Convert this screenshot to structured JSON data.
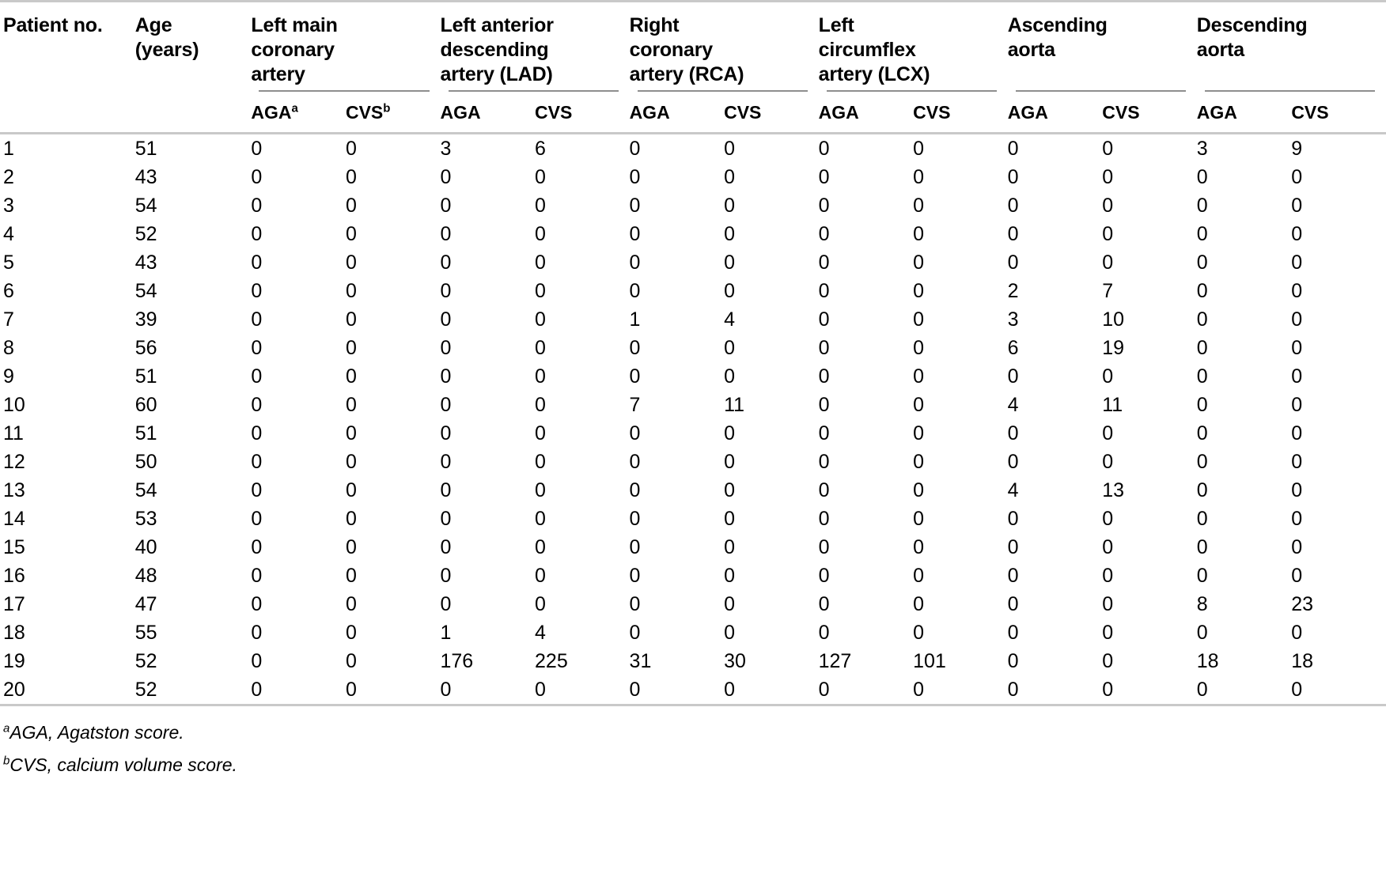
{
  "table": {
    "header": {
      "patient_no": "Patient no.",
      "age": "Age\n(years)",
      "age_line1": "Age",
      "age_line2": "(years)",
      "groups": [
        {
          "title": "Left main coronary artery",
          "lines": [
            "Left main",
            "coronary",
            "artery"
          ],
          "sub": [
            "AGA",
            "CVS"
          ],
          "sub_marks": [
            "a",
            "b"
          ]
        },
        {
          "title": "Left anterior descending artery (LAD)",
          "lines": [
            "Left anterior",
            "descending",
            "artery (LAD)"
          ],
          "sub": [
            "AGA",
            "CVS"
          ],
          "sub_marks": [
            "",
            ""
          ]
        },
        {
          "title": "Right coronary artery (RCA)",
          "lines": [
            "Right",
            "coronary",
            "artery (RCA)"
          ],
          "sub": [
            "AGA",
            "CVS"
          ],
          "sub_marks": [
            "",
            ""
          ]
        },
        {
          "title": "Left circumflex artery (LCX)",
          "lines": [
            "Left",
            "circumflex",
            "artery (LCX)"
          ],
          "sub": [
            "AGA",
            "CVS"
          ],
          "sub_marks": [
            "",
            ""
          ]
        },
        {
          "title": "Ascending aorta",
          "lines": [
            "Ascending",
            "aorta"
          ],
          "sub": [
            "AGA",
            "CVS"
          ],
          "sub_marks": [
            "",
            ""
          ]
        },
        {
          "title": "Descending aorta",
          "lines": [
            "Descending",
            "aorta"
          ],
          "sub": [
            "AGA",
            "CVS"
          ],
          "sub_marks": [
            "",
            ""
          ]
        }
      ]
    },
    "columns": [
      "Patient no.",
      "Age (years)",
      "Left main coronary artery AGA",
      "Left main coronary artery CVS",
      "LAD AGA",
      "LAD CVS",
      "RCA AGA",
      "RCA CVS",
      "LCX AGA",
      "LCX CVS",
      "Ascending aorta AGA",
      "Ascending aorta CVS",
      "Descending aorta AGA",
      "Descending aorta CVS"
    ],
    "rows": [
      {
        "patient": "1",
        "age": "51",
        "values": [
          "0",
          "0",
          "3",
          "6",
          "0",
          "0",
          "0",
          "0",
          "0",
          "0",
          "3",
          "9"
        ]
      },
      {
        "patient": "2",
        "age": "43",
        "values": [
          "0",
          "0",
          "0",
          "0",
          "0",
          "0",
          "0",
          "0",
          "0",
          "0",
          "0",
          "0"
        ]
      },
      {
        "patient": "3",
        "age": "54",
        "values": [
          "0",
          "0",
          "0",
          "0",
          "0",
          "0",
          "0",
          "0",
          "0",
          "0",
          "0",
          "0"
        ]
      },
      {
        "patient": "4",
        "age": "52",
        "values": [
          "0",
          "0",
          "0",
          "0",
          "0",
          "0",
          "0",
          "0",
          "0",
          "0",
          "0",
          "0"
        ]
      },
      {
        "patient": "5",
        "age": "43",
        "values": [
          "0",
          "0",
          "0",
          "0",
          "0",
          "0",
          "0",
          "0",
          "0",
          "0",
          "0",
          "0"
        ]
      },
      {
        "patient": "6",
        "age": "54",
        "values": [
          "0",
          "0",
          "0",
          "0",
          "0",
          "0",
          "0",
          "0",
          "2",
          "7",
          "0",
          "0"
        ]
      },
      {
        "patient": "7",
        "age": "39",
        "values": [
          "0",
          "0",
          "0",
          "0",
          "1",
          "4",
          "0",
          "0",
          "3",
          "10",
          "0",
          "0"
        ]
      },
      {
        "patient": "8",
        "age": "56",
        "values": [
          "0",
          "0",
          "0",
          "0",
          "0",
          "0",
          "0",
          "0",
          "6",
          "19",
          "0",
          "0"
        ]
      },
      {
        "patient": "9",
        "age": "51",
        "values": [
          "0",
          "0",
          "0",
          "0",
          "0",
          "0",
          "0",
          "0",
          "0",
          "0",
          "0",
          "0"
        ]
      },
      {
        "patient": "10",
        "age": "60",
        "values": [
          "0",
          "0",
          "0",
          "0",
          "7",
          "11",
          "0",
          "0",
          "4",
          "11",
          "0",
          "0"
        ]
      },
      {
        "patient": "11",
        "age": "51",
        "values": [
          "0",
          "0",
          "0",
          "0",
          "0",
          "0",
          "0",
          "0",
          "0",
          "0",
          "0",
          "0"
        ]
      },
      {
        "patient": "12",
        "age": "50",
        "values": [
          "0",
          "0",
          "0",
          "0",
          "0",
          "0",
          "0",
          "0",
          "0",
          "0",
          "0",
          "0"
        ]
      },
      {
        "patient": "13",
        "age": "54",
        "values": [
          "0",
          "0",
          "0",
          "0",
          "0",
          "0",
          "0",
          "0",
          "4",
          "13",
          "0",
          "0"
        ]
      },
      {
        "patient": "14",
        "age": "53",
        "values": [
          "0",
          "0",
          "0",
          "0",
          "0",
          "0",
          "0",
          "0",
          "0",
          "0",
          "0",
          "0"
        ]
      },
      {
        "patient": "15",
        "age": "40",
        "values": [
          "0",
          "0",
          "0",
          "0",
          "0",
          "0",
          "0",
          "0",
          "0",
          "0",
          "0",
          "0"
        ]
      },
      {
        "patient": "16",
        "age": "48",
        "values": [
          "0",
          "0",
          "0",
          "0",
          "0",
          "0",
          "0",
          "0",
          "0",
          "0",
          "0",
          "0"
        ]
      },
      {
        "patient": "17",
        "age": "47",
        "values": [
          "0",
          "0",
          "0",
          "0",
          "0",
          "0",
          "0",
          "0",
          "0",
          "0",
          "8",
          "23"
        ]
      },
      {
        "patient": "18",
        "age": "55",
        "values": [
          "0",
          "0",
          "1",
          "4",
          "0",
          "0",
          "0",
          "0",
          "0",
          "0",
          "0",
          "0"
        ]
      },
      {
        "patient": "19",
        "age": "52",
        "values": [
          "0",
          "0",
          "176",
          "225",
          "31",
          "30",
          "127",
          "101",
          "0",
          "0",
          "18",
          "18"
        ]
      },
      {
        "patient": "20",
        "age": "52",
        "values": [
          "0",
          "0",
          "0",
          "0",
          "0",
          "0",
          "0",
          "0",
          "0",
          "0",
          "0",
          "0"
        ]
      }
    ],
    "footnotes": [
      {
        "mark": "a",
        "text": "AGA, Agatston score."
      },
      {
        "mark": "b",
        "text": "CVS, calcium volume score."
      }
    ]
  },
  "colors": {
    "rule": "#c9c9c9",
    "sub_rule": "#8e8e8e",
    "text": "#000000",
    "background": "#ffffff"
  }
}
